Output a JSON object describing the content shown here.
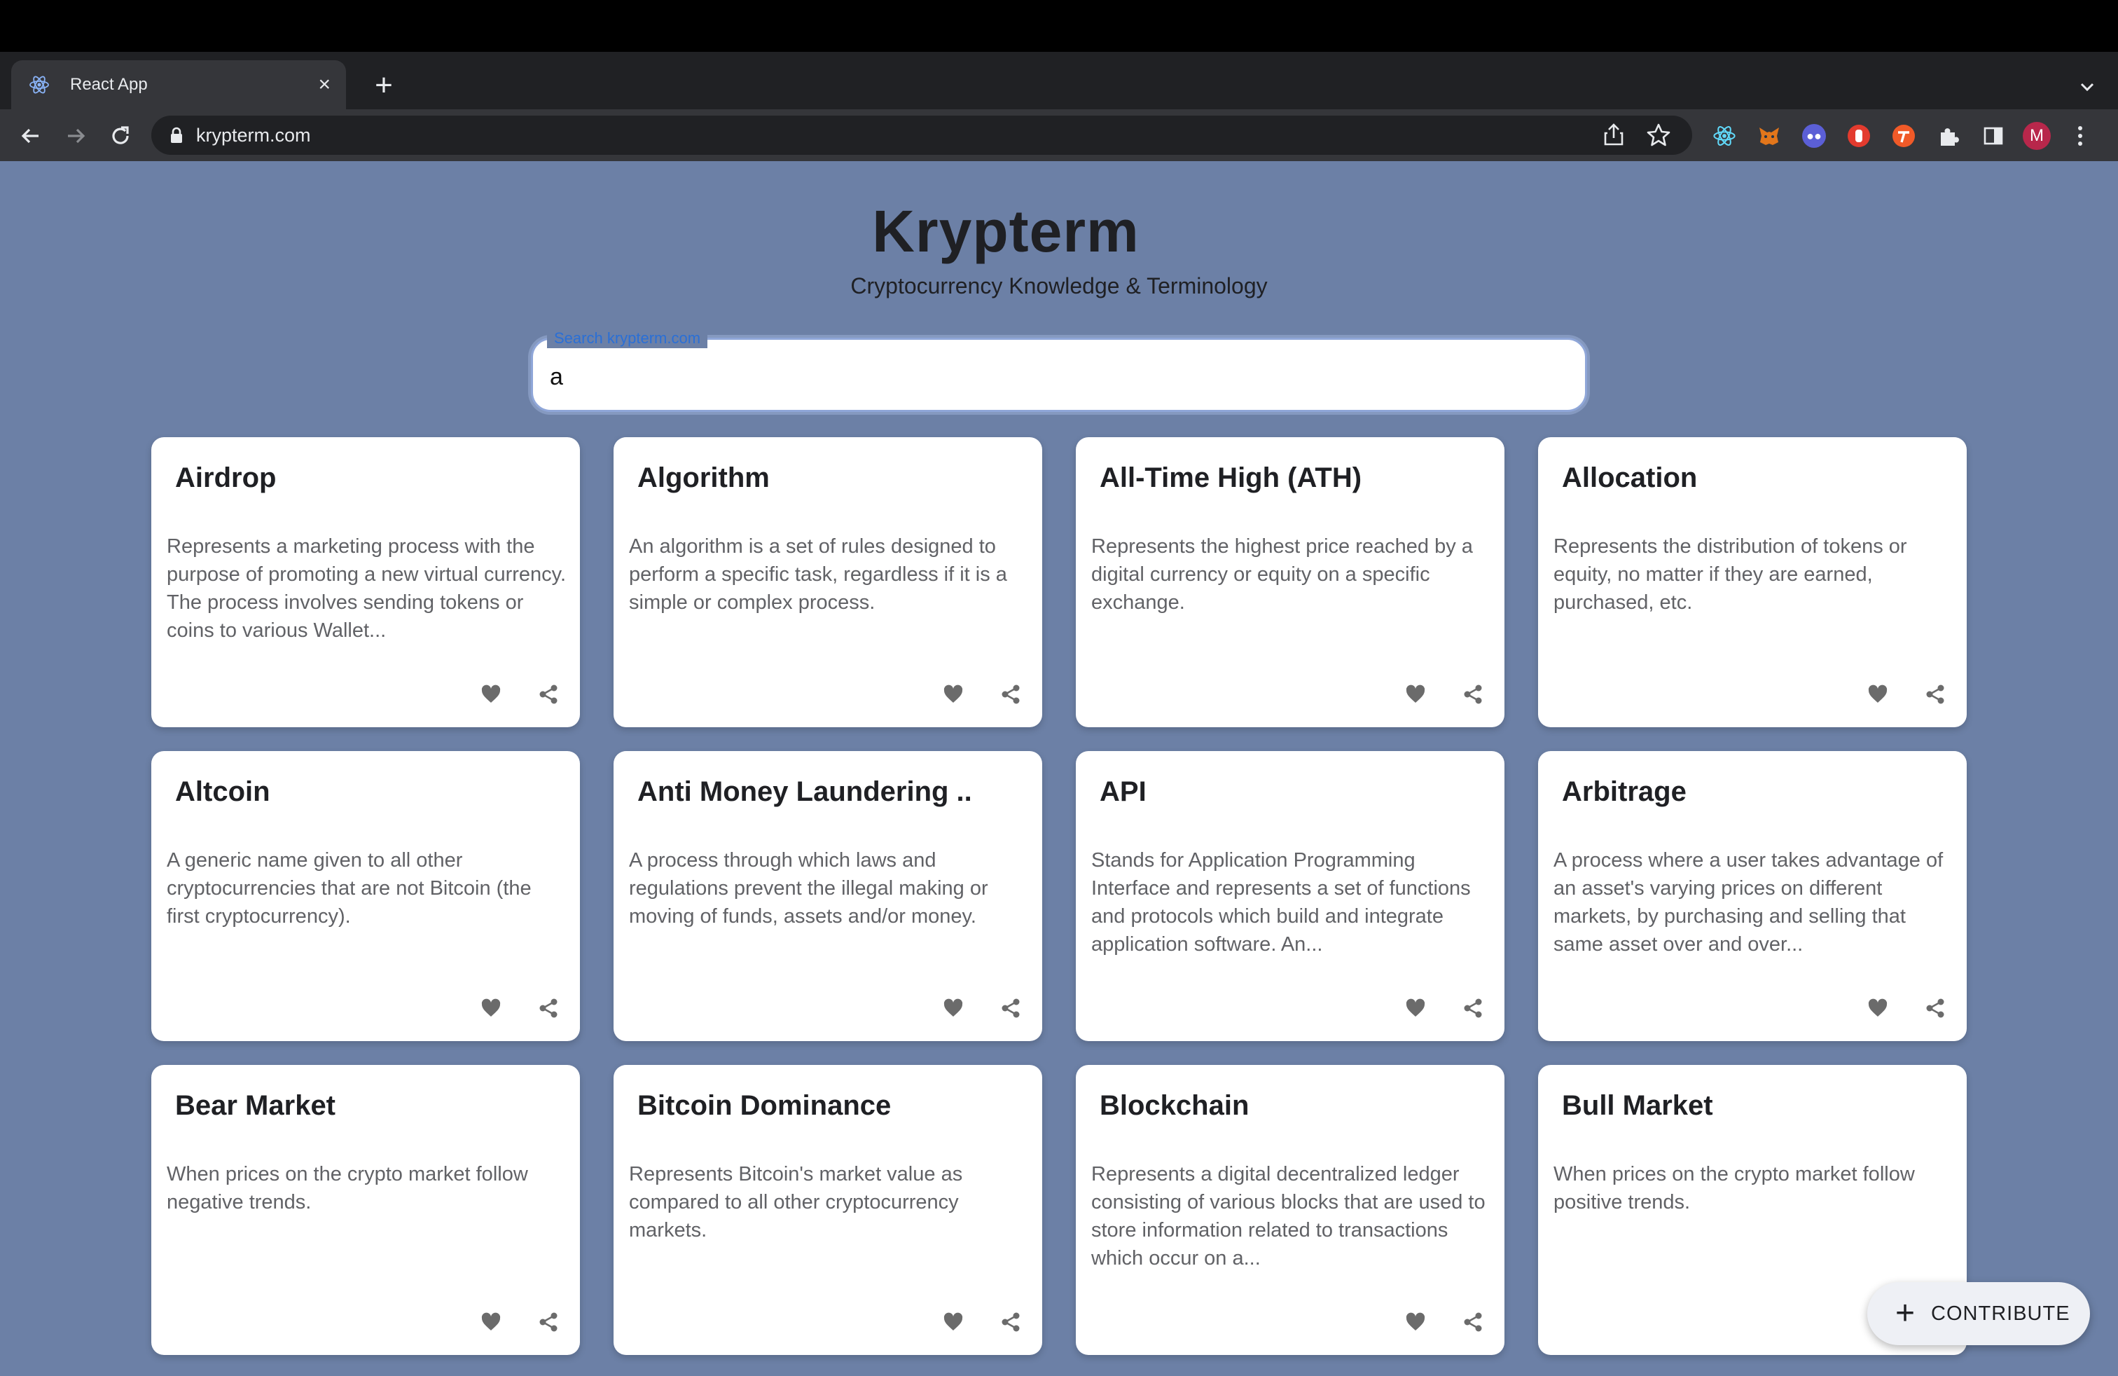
{
  "browser": {
    "tab_title": "React App",
    "url": "krypterm.com",
    "profile_initial": "M"
  },
  "header": {
    "title": "Krypterm",
    "subtitle": "Cryptocurrency Knowledge & Terminology"
  },
  "search": {
    "label": "Search krypterm.com",
    "value": "a"
  },
  "cards": [
    {
      "title": "Airdrop",
      "description": "Represents a marketing process with the purpose of promoting a new virtual currency. The process involves sending tokens or coins to various Wallet..."
    },
    {
      "title": "Algorithm",
      "description": "An algorithm is a set of rules designed to perform a specific task, regardless if it is a simple or complex process."
    },
    {
      "title": "All-Time High (ATH)",
      "description": "Represents the highest price reached by a digital currency or equity on a specific exchange."
    },
    {
      "title": "Allocation",
      "description": "Represents the distribution of tokens or equity, no matter if they are earned, purchased, etc."
    },
    {
      "title": "Altcoin",
      "description": "A generic name given to all other cryptocurrencies that are not Bitcoin (the first cryptocurrency)."
    },
    {
      "title": "Anti Money Laundering ..",
      "description": "A process through which laws and regulations prevent the illegal making or moving of funds, assets and/or money."
    },
    {
      "title": "API",
      "description": "Stands for Application Programming Interface and represents a set of functions and protocols which build and integrate application software. An..."
    },
    {
      "title": "Arbitrage",
      "description": "A process where a user takes advantage of an asset's varying prices on different markets, by purchasing and selling that same asset over and over..."
    },
    {
      "title": "Bear Market",
      "description": "When prices on the crypto market follow negative trends."
    },
    {
      "title": "Bitcoin Dominance",
      "description": "Represents Bitcoin's market value as compared to all other cryptocurrency markets."
    },
    {
      "title": "Blockchain",
      "description": "Represents a digital decentralized ledger consisting of various blocks that are used to store information related to transactions which occur on a..."
    },
    {
      "title": "Bull Market",
      "description": "When prices on the crypto market follow positive trends."
    }
  ],
  "fab": {
    "label": "CONTRIBUTE"
  },
  "icons": {
    "tab_favicon": "react-icon",
    "favorite": "heart-icon",
    "share": "share-icon"
  },
  "colors": {
    "page_background": "#6c80a6",
    "card_background": "#ffffff",
    "search_label": "#2a6fd6",
    "profile_avatar": "#b8274b"
  }
}
